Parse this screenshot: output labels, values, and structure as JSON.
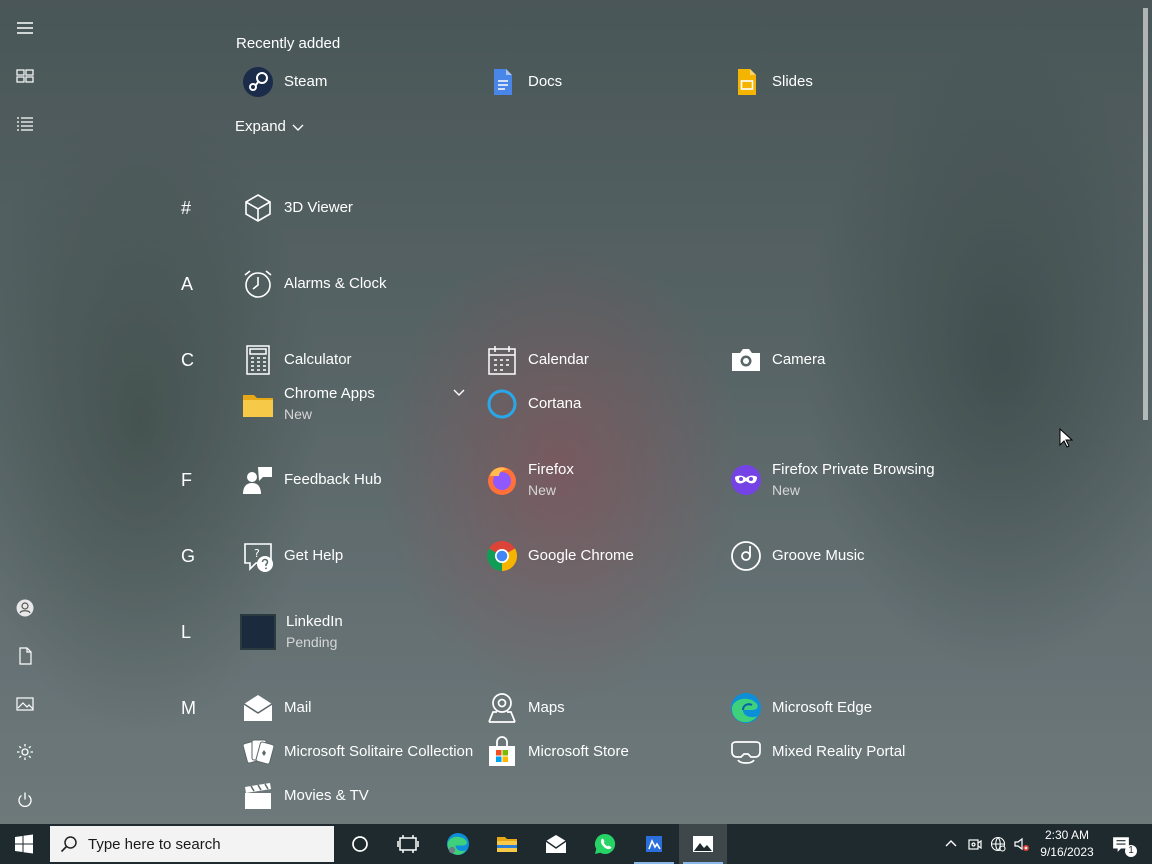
{
  "start_menu": {
    "rail": {
      "items": [
        {
          "name": "hamburger-menu-icon"
        },
        {
          "name": "tiles-icon"
        },
        {
          "name": "all-apps-list-icon"
        },
        {
          "name": "user-account-icon"
        },
        {
          "name": "documents-icon"
        },
        {
          "name": "pictures-icon"
        },
        {
          "name": "settings-icon"
        },
        {
          "name": "power-icon"
        }
      ]
    },
    "recently_added": {
      "title": "Recently added",
      "apps": [
        {
          "label": "Steam",
          "icon": "steam-icon"
        },
        {
          "label": "Docs",
          "icon": "docs-icon"
        },
        {
          "label": "Slides",
          "icon": "slides-icon"
        }
      ],
      "expand_label": "Expand"
    },
    "letters": [
      "#",
      "A",
      "C",
      "F",
      "G",
      "L",
      "M"
    ],
    "apps": {
      "viewer3d": {
        "label": "3D Viewer",
        "icon": "cube-icon"
      },
      "alarms": {
        "label": "Alarms & Clock",
        "icon": "alarm-clock-icon"
      },
      "calculator": {
        "label": "Calculator",
        "icon": "calculator-icon"
      },
      "calendar": {
        "label": "Calendar",
        "icon": "calendar-icon"
      },
      "camera": {
        "label": "Camera",
        "icon": "camera-icon"
      },
      "chrome_apps": {
        "label": "Chrome Apps",
        "sub": "New",
        "icon": "folder-icon"
      },
      "cortana": {
        "label": "Cortana",
        "icon": "cortana-icon"
      },
      "feedback": {
        "label": "Feedback Hub",
        "icon": "feedback-icon"
      },
      "firefox": {
        "label": "Firefox",
        "sub": "New",
        "icon": "firefox-icon"
      },
      "firefox_private": {
        "label": "Firefox Private Browsing",
        "sub": "New",
        "icon": "firefox-private-icon"
      },
      "get_help": {
        "label": "Get Help",
        "icon": "help-icon"
      },
      "chrome": {
        "label": "Google Chrome",
        "icon": "chrome-icon"
      },
      "groove": {
        "label": "Groove Music",
        "icon": "groove-icon"
      },
      "linkedin": {
        "label": "LinkedIn",
        "sub": "Pending",
        "icon": "linkedin-icon"
      },
      "mail": {
        "label": "Mail",
        "icon": "mail-icon"
      },
      "maps": {
        "label": "Maps",
        "icon": "maps-icon"
      },
      "edge": {
        "label": "Microsoft Edge",
        "icon": "edge-icon"
      },
      "solitaire": {
        "label": "Microsoft Solitaire Collection",
        "icon": "cards-icon"
      },
      "store": {
        "label": "Microsoft Store",
        "icon": "store-icon"
      },
      "mixed_reality": {
        "label": "Mixed Reality Portal",
        "icon": "vr-headset-icon"
      },
      "movies": {
        "label": "Movies & TV",
        "icon": "clapper-icon"
      }
    }
  },
  "taskbar": {
    "search_placeholder": "Type here to search",
    "pinned": [
      {
        "name": "cortana-taskbar-icon"
      },
      {
        "name": "task-view-icon"
      },
      {
        "name": "edge-taskbar-icon"
      },
      {
        "name": "file-explorer-icon"
      },
      {
        "name": "mail-taskbar-icon"
      },
      {
        "name": "whatsapp-icon"
      },
      {
        "name": "app-taskbar-icon"
      },
      {
        "name": "photos-taskbar-icon"
      }
    ],
    "clock": {
      "time": "2:30 AM",
      "date": "9/16/2023"
    },
    "notification_count": "1",
    "colors": {
      "taskbar_bg": "#1f2a2e",
      "accent": "#8bb8e8"
    }
  }
}
